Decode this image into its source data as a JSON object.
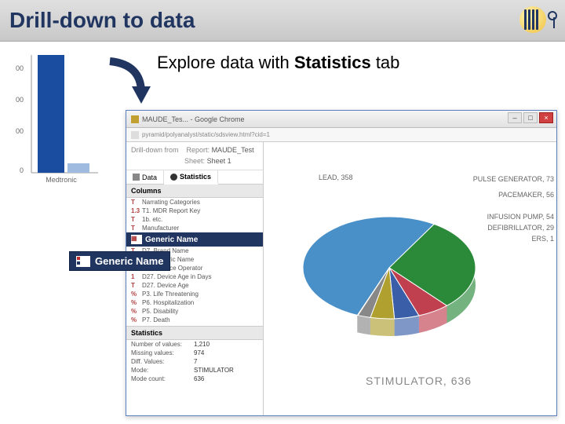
{
  "slide": {
    "title": "Drill-down to data",
    "subtitle_pre": "Explore data with ",
    "subtitle_bold": "Statistics",
    "subtitle_post": " tab"
  },
  "barfrag": {
    "ticks": [
      "00",
      "00",
      "00",
      "0"
    ],
    "xlabel": "Medtronic"
  },
  "browser": {
    "title": "MAUDE_Tes... - Google Chrome",
    "url": "pyramid/polyanalyst/static/sdsview.html?cid=1",
    "drilldown_label": "Drill-down from",
    "report_label": "Report:",
    "report_value": "MAUDE_Test",
    "sheet_label": "Sheet:",
    "sheet_value": "Sheet 1"
  },
  "tabs": {
    "data": "Data",
    "stats": "Statistics"
  },
  "columns_header": "Columns",
  "columns": [
    {
      "icon": "T",
      "label": "Narrating Categories"
    },
    {
      "icon": "1.3",
      "label": "T1. MDR Report Key"
    },
    {
      "icon": "T",
      "label": "1b. etc."
    },
    {
      "icon": "T",
      "label": "Manufacturer"
    },
    {
      "icon": "▦",
      "label": "Generic Name",
      "highlight": true
    },
    {
      "icon": "T",
      "label": "D7. Brand Name"
    },
    {
      "icon": "T",
      "label": "D9. Generic Name"
    },
    {
      "icon": "T",
      "label": "D23. Device Operator"
    },
    {
      "icon": "1",
      "label": "D27. Device Age in Days"
    },
    {
      "icon": "T",
      "label": "D27. Device Age"
    },
    {
      "icon": "%",
      "label": "P3. Life Threatening"
    },
    {
      "icon": "%",
      "label": "P6. Hospitalization"
    },
    {
      "icon": "%",
      "label": "P5. Disability"
    },
    {
      "icon": "%",
      "label": "P7. Death"
    }
  ],
  "callout": "Generic Name",
  "stats_header": "Statistics",
  "stats": [
    {
      "k": "Number of values:",
      "v": "1,210"
    },
    {
      "k": "Missing values:",
      "v": "974"
    },
    {
      "k": "Diff. Values:",
      "v": "7"
    },
    {
      "k": "Mode:",
      "v": "STIMULATOR"
    },
    {
      "k": "Mode count:",
      "v": "636"
    }
  ],
  "chart_data": {
    "type": "pie",
    "title": "",
    "series": [
      {
        "name": "STIMULATOR",
        "value": 636,
        "color": "#4a90c8"
      },
      {
        "name": "LEAD",
        "value": 358,
        "color": "#2a8a3a"
      },
      {
        "name": "PULSE GENERATOR",
        "value": 73,
        "color": "#c04050"
      },
      {
        "name": "PACEMAKER",
        "value": 56,
        "color": "#3a5fa8"
      },
      {
        "name": "INFUSION PUMP",
        "value": 54,
        "color": "#b0a030"
      },
      {
        "name": "DEFIBRILLATOR",
        "value": 29,
        "color": "#888888"
      },
      {
        "name": "ERS",
        "value": 1,
        "color": "#555555"
      }
    ],
    "big_label": "STIMULATOR, 636",
    "labels": {
      "lead": "LEAD, 358",
      "pulse": "PULSE GENERATOR, 73",
      "pace": "PACEMAKER, 56",
      "pump": "INFUSION PUMP, 54",
      "defib": "DEFIBRILLATOR, 29",
      "ers": "ERS, 1"
    }
  }
}
